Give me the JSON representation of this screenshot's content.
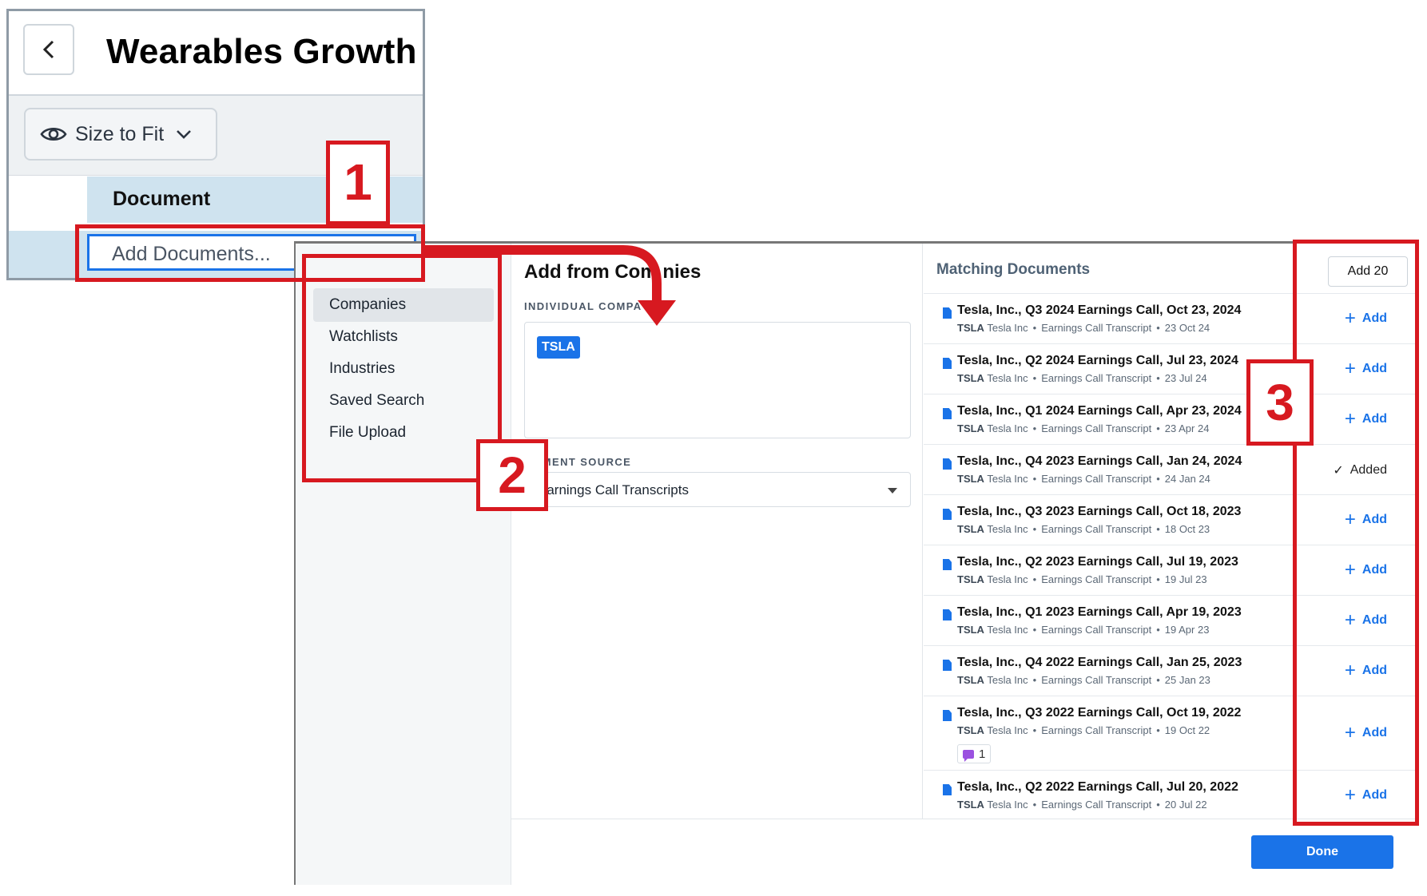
{
  "inset": {
    "title": "Wearables Growth",
    "size_to_fit_label": "Size to Fit",
    "column_header": "Document",
    "add_documents_label": "Add Documents..."
  },
  "modal": {
    "nav": [
      "Companies",
      "Watchlists",
      "Industries",
      "Saved Search",
      "File Upload"
    ],
    "active_nav": "Companies",
    "mid": {
      "title": "Add from Com    nies",
      "individual_label": "INDIVIDUAL COMPA",
      "ticker_tag": "TSLA",
      "source_label": "UMENT SOURCE",
      "source_value": "Earnings Call Transcripts"
    },
    "right": {
      "title": "Matching Documents",
      "add_all_label": "Add 20",
      "documents": [
        {
          "title": "Tesla, Inc., Q3 2024 Earnings Call, Oct 23, 2024",
          "ticker": "TSLA",
          "company": "Tesla Inc",
          "type": "Earnings Call Transcript",
          "date": "23 Oct 24",
          "action": "Add"
        },
        {
          "title": "Tesla, Inc., Q2 2024 Earnings Call, Jul 23, 2024",
          "ticker": "TSLA",
          "company": "Tesla Inc",
          "type": "Earnings Call Transcript",
          "date": "23 Jul 24",
          "action": "Add"
        },
        {
          "title": "Tesla, Inc., Q1 2024 Earnings Call, Apr 23, 2024",
          "ticker": "TSLA",
          "company": "Tesla Inc",
          "type": "Earnings Call Transcript",
          "date": "23 Apr 24",
          "action": "Add"
        },
        {
          "title": "Tesla, Inc., Q4 2023 Earnings Call, Jan 24, 2024",
          "ticker": "TSLA",
          "company": "Tesla Inc",
          "type": "Earnings Call Transcript",
          "date": "24 Jan 24",
          "action": "Added"
        },
        {
          "title": "Tesla, Inc., Q3 2023 Earnings Call, Oct 18, 2023",
          "ticker": "TSLA",
          "company": "Tesla Inc",
          "type": "Earnings Call Transcript",
          "date": "18 Oct 23",
          "action": "Add"
        },
        {
          "title": "Tesla, Inc., Q2 2023 Earnings Call, Jul 19, 2023",
          "ticker": "TSLA",
          "company": "Tesla Inc",
          "type": "Earnings Call Transcript",
          "date": "19 Jul 23",
          "action": "Add"
        },
        {
          "title": "Tesla, Inc., Q1 2023 Earnings Call, Apr 19, 2023",
          "ticker": "TSLA",
          "company": "Tesla Inc",
          "type": "Earnings Call Transcript",
          "date": "19 Apr 23",
          "action": "Add"
        },
        {
          "title": "Tesla, Inc., Q4 2022 Earnings Call, Jan 25, 2023",
          "ticker": "TSLA",
          "company": "Tesla Inc",
          "type": "Earnings Call Transcript",
          "date": "25 Jan 23",
          "action": "Add"
        },
        {
          "title": "Tesla, Inc., Q3 2022 Earnings Call, Oct 19, 2022",
          "ticker": "TSLA",
          "company": "Tesla Inc",
          "type": "Earnings Call Transcript",
          "date": "19 Oct 22",
          "action": "Add",
          "comments": "1"
        },
        {
          "title": "Tesla, Inc., Q2 2022 Earnings Call, Jul 20, 2022",
          "ticker": "TSLA",
          "company": "Tesla Inc",
          "type": "Earnings Call Transcript",
          "date": "20 Jul 22",
          "action": "Add"
        }
      ]
    },
    "done_label": "Done"
  },
  "annotations": {
    "step1": "1",
    "step2": "2",
    "step3": "3",
    "color": "#d71920"
  },
  "colors": {
    "accent": "#1a73e8",
    "selected_row": "#cfe3ef"
  }
}
